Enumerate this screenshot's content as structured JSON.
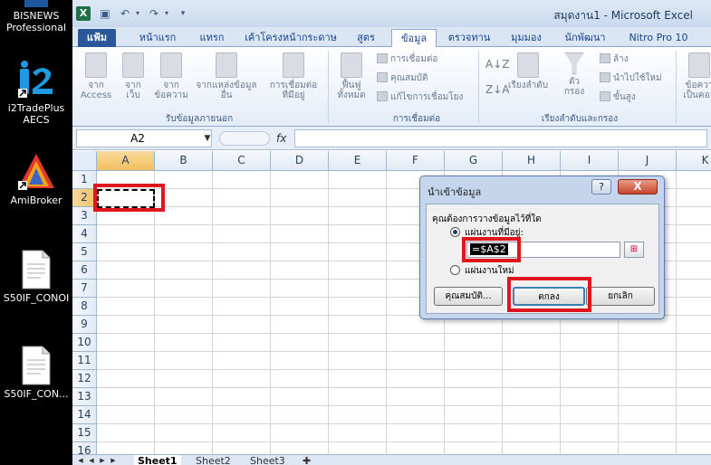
{
  "desktop": {
    "icons": [
      {
        "label1": "BISNEWS",
        "label2": "Professional"
      },
      {
        "label1": "i2TradePlus",
        "label2": "AECS"
      },
      {
        "label1": "AmiBroker",
        "label2": ""
      },
      {
        "label1": "S50IF_CONOI",
        "label2": ""
      },
      {
        "label1": "S50IF_CON...",
        "label2": ""
      }
    ]
  },
  "window": {
    "title": "สมุดงาน1 - Microsoft Excel",
    "logo": "X"
  },
  "tabs": [
    "แฟ้ม",
    "หน้าแรก",
    "แทรก",
    "เค้าโครงหน้ากระดาษ",
    "สูตร",
    "ข้อมูล",
    "ตรวจทาน",
    "มุมมอง",
    "นักพัฒนา",
    "Nitro Pro 10"
  ],
  "ribbon": {
    "btn_access_1": "จาก",
    "btn_access_2": "Access",
    "btn_web_1": "จาก",
    "btn_web_2": "เว็บ",
    "btn_text_1": "จาก",
    "btn_text_2": "ข้อความ",
    "btn_other_1": "จากแหล่งข้อมูล",
    "btn_other_2": "อื่น",
    "btn_existing_1": "การเชื่อมต่อ",
    "btn_existing_2": "ที่มีอยู่",
    "group_external": "รับข้อมูลภายนอก",
    "btn_refresh_1": "ฟื้นฟู",
    "btn_refresh_2": "ทั้งหมด",
    "small_connections": "การเชื่อมต่อ",
    "small_properties": "คุณสมบัติ",
    "small_editlinks": "แก้ไขการเชื่อมโยง",
    "group_connections": "การเชื่อมต่อ",
    "btn_sort": "เรียงลำดับ",
    "btn_filter_1": "ตัว",
    "btn_filter_2": "กรอง",
    "small_clear": "ล้าง",
    "small_reapply": "นำไปใช้ใหม่",
    "small_advanced": "ขั้นสูง",
    "group_sortfilter": "เรียงลำดับและกรอง",
    "btn_texttocol_1": "ข้อควา",
    "btn_texttocol_2": "เป็นคอล"
  },
  "formula_bar": {
    "name_box": "A2",
    "fx": "fx",
    "value": ""
  },
  "grid": {
    "columns": [
      "A",
      "B",
      "C",
      "D",
      "E",
      "F",
      "G",
      "H",
      "I",
      "J",
      "K"
    ],
    "rows": [
      "1",
      "2",
      "3",
      "4",
      "5",
      "6",
      "7",
      "8",
      "9",
      "10",
      "11",
      "12",
      "13",
      "14",
      "15",
      "16"
    ],
    "selected_cell": "A2"
  },
  "sheets": [
    "Sheet1",
    "Sheet2",
    "Sheet3"
  ],
  "dialog": {
    "title": "นำเข้าข้อมูล",
    "help": "?",
    "close": "X",
    "question": "คุณต้องการวางข้อมูลไว้ที่ใด",
    "option_existing": "แผ่นงานที่มีอยู่:",
    "reference": "=$A$2",
    "option_new": "แผ่นงานใหม่",
    "btn_properties": "คุณสมบัติ...",
    "btn_ok": "ตกลง",
    "btn_cancel": "ยกเลิก"
  }
}
